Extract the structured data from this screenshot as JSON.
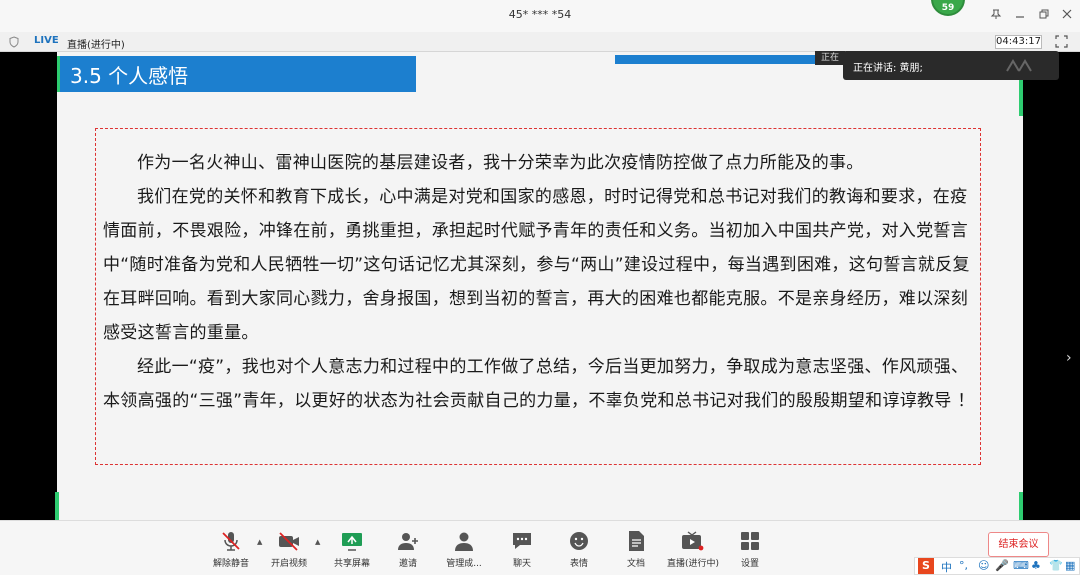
{
  "window": {
    "title": "45* *** *54",
    "avatar_count": "59"
  },
  "statusbar": {
    "live_badge": "LIVE",
    "live_status": "直播(进行中)",
    "timer": "04:43:17"
  },
  "slide": {
    "title": "3.5 个人感悟",
    "paragraphs": [
      "作为一名火神山、雷神山医院的基层建设者，我十分荣幸为此次疫情防控做了点力所能及的事。",
      "我们在党的关怀和教育下成长，心中满是对党和国家的感恩，时时记得党和总书记对我们的教诲和要求，在疫情面前，不畏艰险，冲锋在前，勇挑重担，承担起时代赋予青年的责任和义务。当初加入中国共产党，对入党誓言中“随时准备为党和人民牺牲一切”这句话记忆尤其深刻，参与“两山”建设过程中，每当遇到困难，这句誓言就反复在耳畔回响。看到大家同心戮力，舍身报国，想到当初的誓言，再大的困难也都能克服。不是亲身经历，难以深刻感受这誓言的重量。",
      "经此一“疫”，我也对个人意志力和过程中的工作做了总结，今后当更加努力，争取成为意志坚强、作风顽强、本领高强的“三强”青年，以更好的状态为社会贡献自己的力量，不辜负党和总书记对我们的殷殷期望和谆谆教导 ！"
    ]
  },
  "speaking": {
    "label": "正在讲话: 黄朋;",
    "prefix": "正在讲"
  },
  "toolbar": {
    "items": [
      {
        "label": "解除静音",
        "icon": "mic-muted-icon"
      },
      {
        "label": "开启视频",
        "icon": "video-off-icon"
      },
      {
        "label": "共享屏幕",
        "icon": "share-screen-icon"
      },
      {
        "label": "邀请",
        "icon": "invite-icon"
      },
      {
        "label": "管理成...",
        "icon": "members-icon"
      },
      {
        "label": "聊天",
        "icon": "chat-icon"
      },
      {
        "label": "表情",
        "icon": "emoji-icon"
      },
      {
        "label": "文档",
        "icon": "document-icon"
      },
      {
        "label": "直播(进行中)",
        "icon": "live-icon"
      },
      {
        "label": "设置",
        "icon": "settings-icon"
      }
    ],
    "end_label": "结束会议"
  },
  "ime": {
    "mode": "中"
  },
  "colors": {
    "accent": "#1c7fcf",
    "live": "#1e73be",
    "end": "#dd2222",
    "border_dash": "#dd3333"
  }
}
